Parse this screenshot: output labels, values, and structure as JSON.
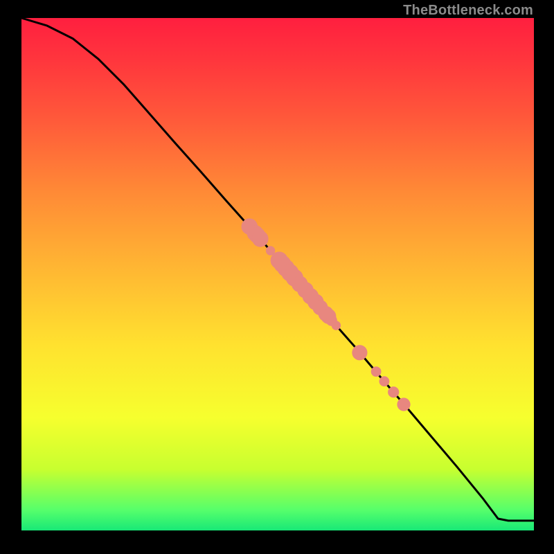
{
  "watermark": "TheBottleneck.com",
  "chart_data": {
    "type": "line",
    "title": "",
    "xlabel": "",
    "ylabel": "",
    "xlim": [
      0,
      100
    ],
    "ylim": [
      0,
      100
    ],
    "line": {
      "x": [
        0,
        5,
        10,
        15,
        20,
        25,
        30,
        35,
        40,
        45,
        50,
        55,
        60,
        65,
        70,
        75,
        80,
        85,
        90,
        93,
        95,
        100
      ],
      "y": [
        100,
        98.5,
        96,
        92,
        87,
        81.3,
        75.6,
        70,
        64.3,
        58.7,
        53,
        47.3,
        41.6,
        35.9,
        30,
        24.2,
        18.3,
        12.4,
        6.3,
        2.3,
        1.9,
        1.9
      ]
    },
    "points": [
      {
        "x": 44.5,
        "y": 59.3,
        "r": 1.6
      },
      {
        "x": 45.6,
        "y": 58.0,
        "r": 1.6
      },
      {
        "x": 46.0,
        "y": 57.6,
        "r": 1.6
      },
      {
        "x": 46.6,
        "y": 56.9,
        "r": 1.6
      },
      {
        "x": 48.6,
        "y": 54.6,
        "r": 0.9
      },
      {
        "x": 50.3,
        "y": 52.7,
        "r": 1.7
      },
      {
        "x": 50.9,
        "y": 52.0,
        "r": 1.7
      },
      {
        "x": 51.6,
        "y": 51.2,
        "r": 1.7
      },
      {
        "x": 52.4,
        "y": 50.3,
        "r": 1.7
      },
      {
        "x": 53.3,
        "y": 49.3,
        "r": 1.7
      },
      {
        "x": 54.3,
        "y": 48.1,
        "r": 1.6
      },
      {
        "x": 55.4,
        "y": 46.9,
        "r": 1.6
      },
      {
        "x": 56.4,
        "y": 45.7,
        "r": 1.6
      },
      {
        "x": 57.4,
        "y": 44.6,
        "r": 1.6
      },
      {
        "x": 58.3,
        "y": 43.5,
        "r": 1.5
      },
      {
        "x": 59.4,
        "y": 42.3,
        "r": 1.5
      },
      {
        "x": 59.9,
        "y": 41.8,
        "r": 1.5
      },
      {
        "x": 60.5,
        "y": 41.0,
        "r": 1.1
      },
      {
        "x": 61.4,
        "y": 40.0,
        "r": 0.9
      },
      {
        "x": 66.0,
        "y": 34.7,
        "r": 1.5
      },
      {
        "x": 69.2,
        "y": 31.0,
        "r": 1.0
      },
      {
        "x": 70.8,
        "y": 29.1,
        "r": 1.0
      },
      {
        "x": 72.6,
        "y": 27.0,
        "r": 1.1
      },
      {
        "x": 74.6,
        "y": 24.6,
        "r": 1.3
      }
    ],
    "colors": {
      "line": "#000000",
      "point_fill": "#e8877f",
      "point_stroke": "#e8877f"
    }
  }
}
